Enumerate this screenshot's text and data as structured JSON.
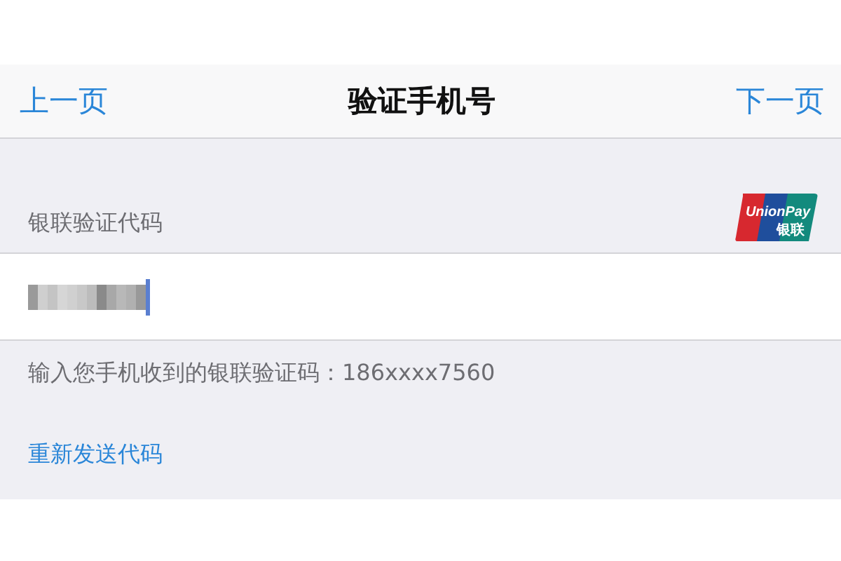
{
  "nav_bar": {
    "back": "上一页",
    "title": "验证手机号",
    "next": "下一页"
  },
  "section": {
    "header": "银联验证代码",
    "logo": {
      "latin": "UnionPay",
      "cjk": "银联"
    }
  },
  "field": {
    "redacted": true,
    "focused": true
  },
  "footer": {
    "hint": "输入您手机收到的银联验证码：",
    "number": "186xxxx7560"
  },
  "resend_link": "重新发送代码"
}
